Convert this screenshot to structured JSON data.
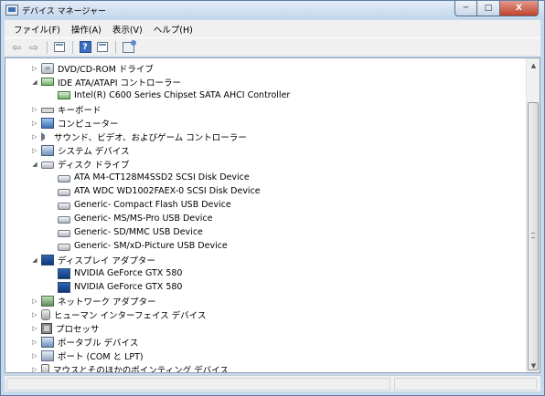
{
  "window": {
    "title": "デバイス マネージャー",
    "buttons": {
      "minimize": "─",
      "maximize": "□",
      "close": "X"
    }
  },
  "menu": [
    "ファイル(F)",
    "操作(A)",
    "表示(V)",
    "ヘルプ(H)"
  ],
  "toolbar": {
    "back": "⇦",
    "forward": "⇨",
    "icons": [
      "back-arrow-icon",
      "forward-arrow-icon",
      "properties-icon",
      "help-icon",
      "properties-alt-icon",
      "scan-hardware-icon"
    ],
    "help_glyph": "?"
  },
  "tree": [
    {
      "label": "DVD/CD-ROM ドライブ",
      "level": 0,
      "expander": "▷",
      "icon": "dvd-drive-icon"
    },
    {
      "label": "IDE ATA/ATAPI コントローラー",
      "level": 0,
      "expander": "◢",
      "icon": "ide-controller-icon"
    },
    {
      "label": "Intel(R) C600 Series Chipset SATA AHCI Controller",
      "level": 1,
      "expander": "",
      "icon": "ide-controller-icon"
    },
    {
      "label": "キーボード",
      "level": 0,
      "expander": "▷",
      "icon": "keyboard-icon"
    },
    {
      "label": "コンピューター",
      "level": 0,
      "expander": "▷",
      "icon": "computer-icon"
    },
    {
      "label": "サウンド、ビデオ、およびゲーム コントローラー",
      "level": 0,
      "expander": "▷",
      "icon": "sound-icon"
    },
    {
      "label": "システム デバイス",
      "level": 0,
      "expander": "▷",
      "icon": "system-device-icon"
    },
    {
      "label": "ディスク ドライブ",
      "level": 0,
      "expander": "◢",
      "icon": "disk-drive-icon"
    },
    {
      "label": "ATA M4-CT128M4SSD2 SCSI Disk Device",
      "level": 1,
      "expander": "",
      "icon": "disk-drive-icon"
    },
    {
      "label": "ATA WDC WD1002FAEX-0 SCSI Disk Device",
      "level": 1,
      "expander": "",
      "icon": "disk-drive-icon"
    },
    {
      "label": "Generic- Compact Flash USB Device",
      "level": 1,
      "expander": "",
      "icon": "disk-drive-icon"
    },
    {
      "label": "Generic- MS/MS-Pro USB Device",
      "level": 1,
      "expander": "",
      "icon": "disk-drive-icon"
    },
    {
      "label": "Generic- SD/MMC USB Device",
      "level": 1,
      "expander": "",
      "icon": "disk-drive-icon"
    },
    {
      "label": "Generic- SM/xD-Picture USB Device",
      "level": 1,
      "expander": "",
      "icon": "disk-drive-icon"
    },
    {
      "label": "ディスプレイ アダプター",
      "level": 0,
      "expander": "◢",
      "icon": "display-adapter-icon"
    },
    {
      "label": "NVIDIA GeForce GTX 580",
      "level": 1,
      "expander": "",
      "icon": "display-adapter-icon"
    },
    {
      "label": "NVIDIA GeForce GTX 580",
      "level": 1,
      "expander": "",
      "icon": "display-adapter-icon"
    },
    {
      "label": "ネットワーク アダプター",
      "level": 0,
      "expander": "▷",
      "icon": "network-adapter-icon"
    },
    {
      "label": "ヒューマン インターフェイス デバイス",
      "level": 0,
      "expander": "▷",
      "icon": "hid-icon"
    },
    {
      "label": "プロセッサ",
      "level": 0,
      "expander": "▷",
      "icon": "processor-icon"
    },
    {
      "label": "ポータブル デバイス",
      "level": 0,
      "expander": "▷",
      "icon": "portable-device-icon"
    },
    {
      "label": "ポート (COM と LPT)",
      "level": 0,
      "expander": "▷",
      "icon": "port-icon"
    },
    {
      "label": "マウスとそのほかのポインティング デバイス",
      "level": 0,
      "expander": "▷",
      "icon": "mouse-icon"
    }
  ],
  "scrollbar": {
    "up": "▲",
    "down": "▼"
  },
  "colors": {
    "frame": "#c7d9ec",
    "close_button": "#c0432c",
    "selection": "#3399ff"
  }
}
